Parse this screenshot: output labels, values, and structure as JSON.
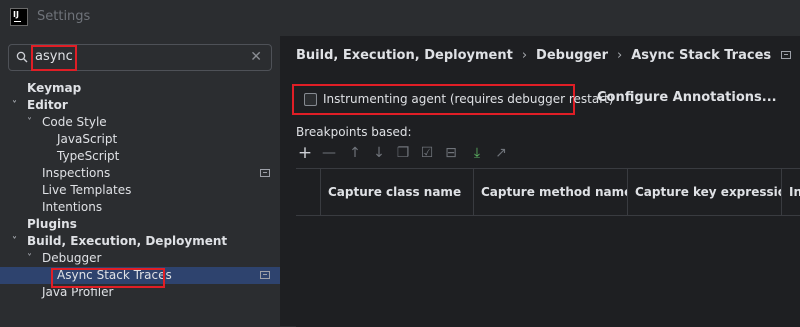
{
  "window": {
    "title": "Settings",
    "logo_text": "IJ"
  },
  "search": {
    "value": "async"
  },
  "tree": [
    {
      "label": "Keymap",
      "bold": true,
      "chevron": ""
    },
    {
      "label": "Editor",
      "bold": true,
      "chevron": "˅"
    },
    {
      "label": "Code Style",
      "bold": false,
      "chevron": "˅"
    },
    {
      "label": "JavaScript",
      "bold": false,
      "chevron": ""
    },
    {
      "label": "TypeScript",
      "bold": false,
      "chevron": ""
    },
    {
      "label": "Inspections",
      "bold": false,
      "chevron": ""
    },
    {
      "label": "Live Templates",
      "bold": false,
      "chevron": ""
    },
    {
      "label": "Intentions",
      "bold": false,
      "chevron": ""
    },
    {
      "label": "Plugins",
      "bold": true,
      "chevron": ""
    },
    {
      "label": "Build, Execution, Deployment",
      "bold": true,
      "chevron": "˅"
    },
    {
      "label": "Debugger",
      "bold": false,
      "chevron": "˅"
    },
    {
      "label": "Async Stack Traces",
      "bold": false,
      "chevron": ""
    },
    {
      "label": "Java Profiler",
      "bold": false,
      "chevron": ""
    }
  ],
  "breadcrumb": [
    "Build, Execution, Deployment",
    "Debugger",
    "Async Stack Traces"
  ],
  "agent": {
    "label": "Instrumenting agent (requires debugger restart)",
    "checked": false
  },
  "configure_button": "Configure Annotations...",
  "breakpoints_label": "Breakpoints based:",
  "toolbar": {
    "add": "+",
    "remove": "—",
    "move_up": "↑",
    "move_down": "↓",
    "copy": "❐",
    "check": "☑",
    "uncheck": "⊟",
    "import": "⤓",
    "export": "↗"
  },
  "table": {
    "columns": [
      "Capture class name",
      "Capture method name",
      "Capture key expression",
      "Insert class name"
    ]
  }
}
